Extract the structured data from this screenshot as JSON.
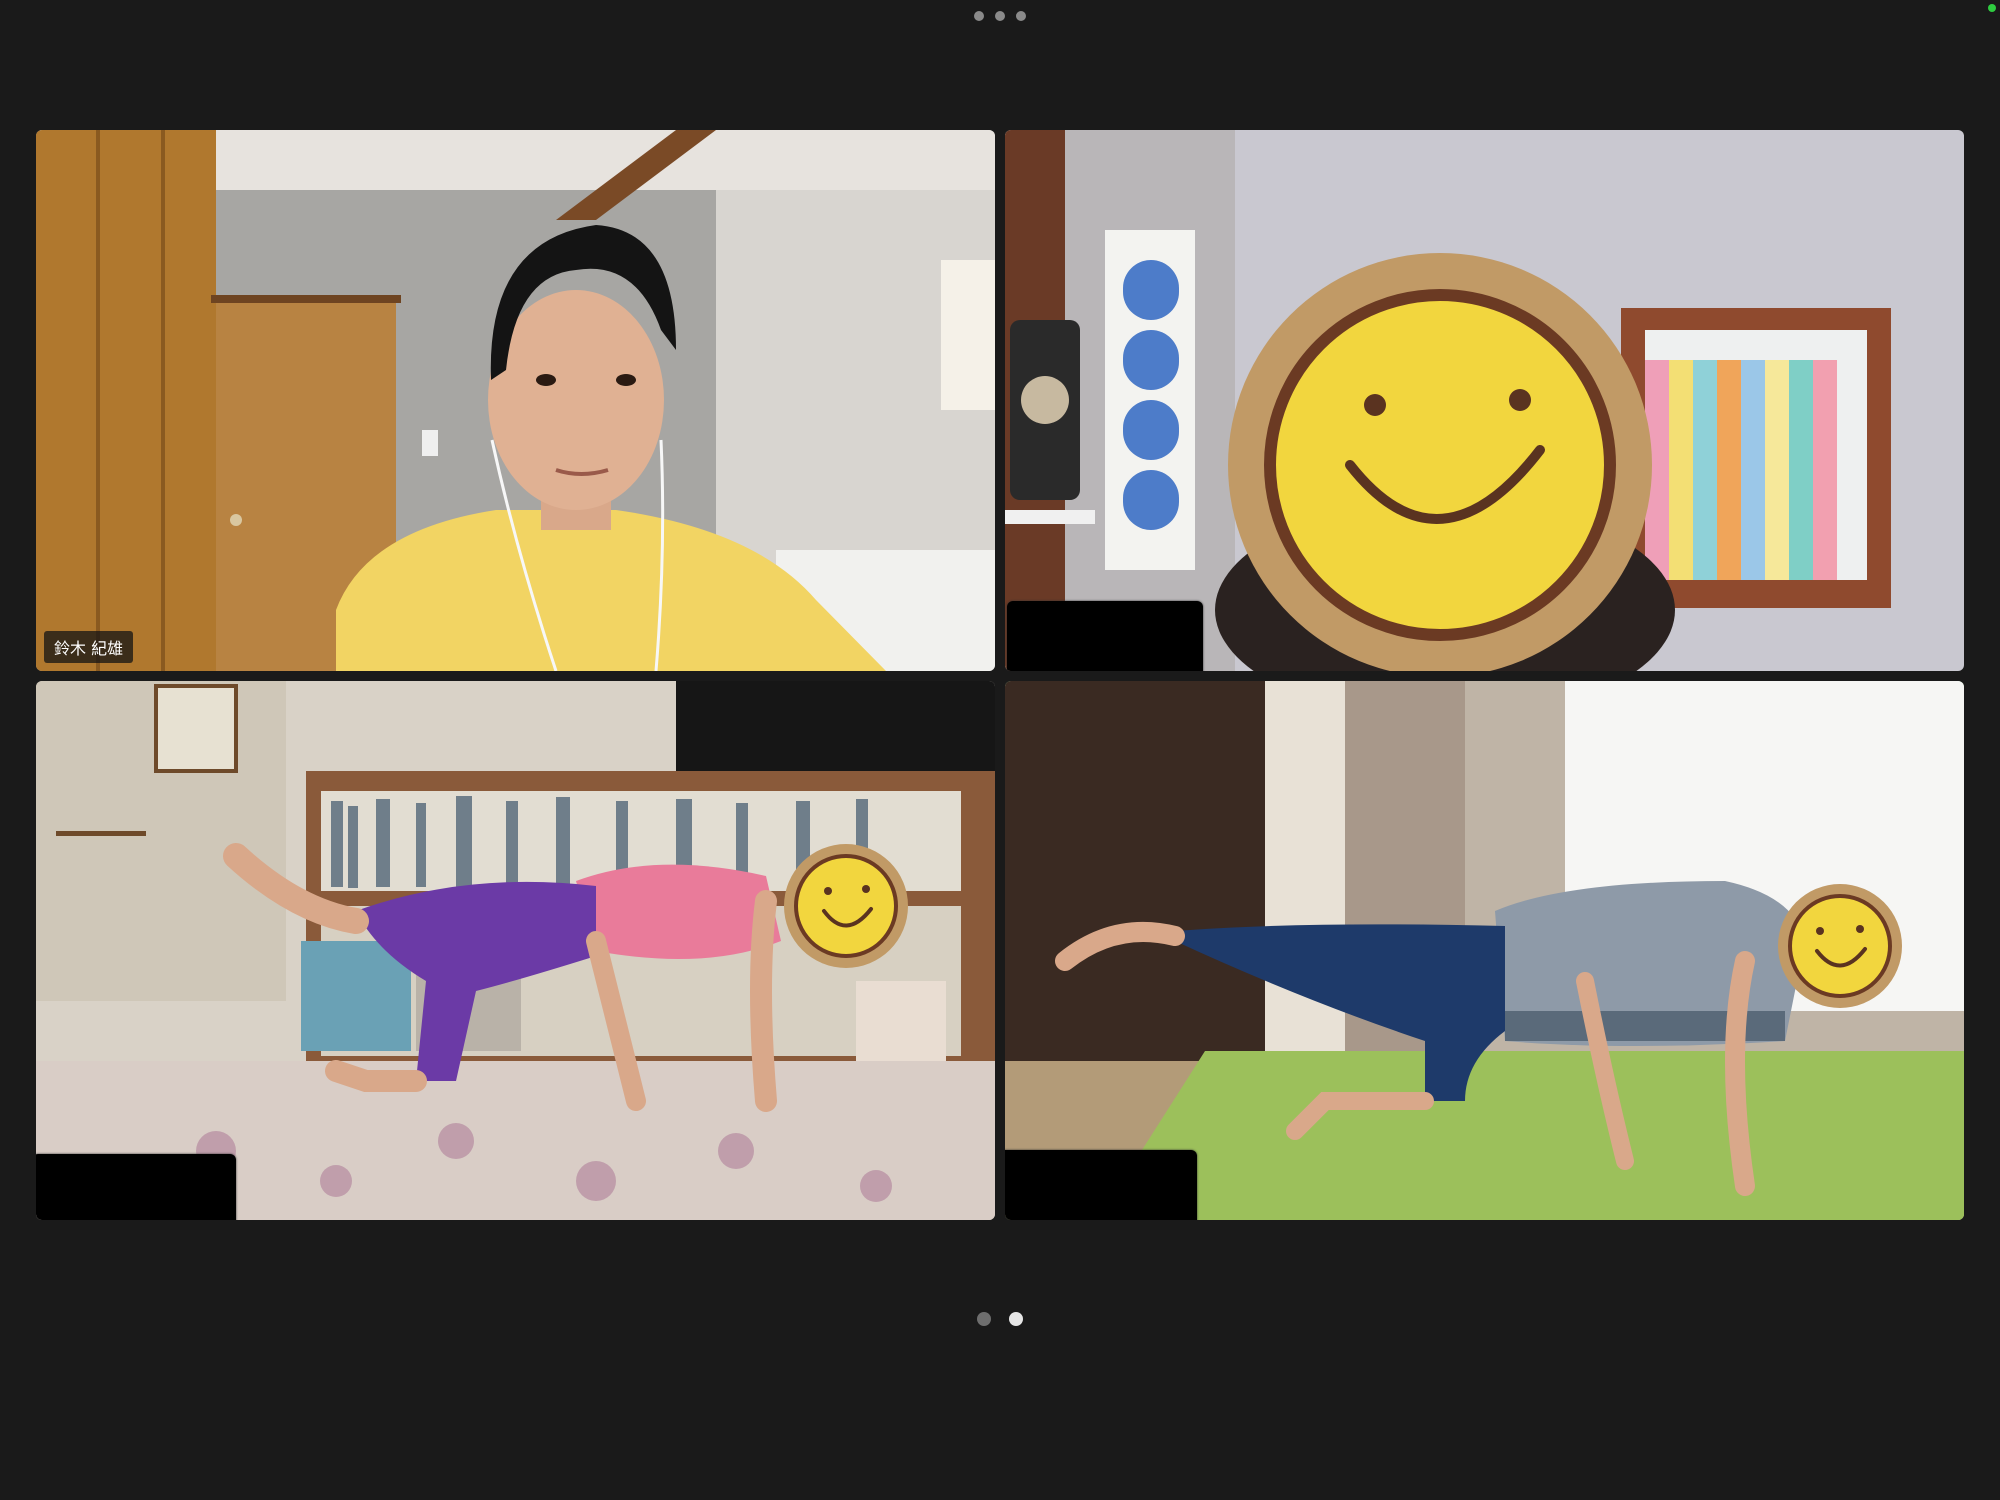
{
  "toolbar": {
    "more_icon": "ellipsis-horizontal-icon"
  },
  "colors": {
    "background": "#1a1a1a",
    "active_speaker_border": "#23d160",
    "status_indicator": "#2ecc40"
  },
  "participants": [
    {
      "name": "鈴木 紀雄",
      "name_visible": true,
      "active_speaker": false
    },
    {
      "name": "",
      "name_visible": false,
      "active_speaker": false,
      "redacted": true
    },
    {
      "name": "",
      "name_visible": false,
      "active_speaker": false,
      "redacted": true
    },
    {
      "name": "",
      "name_visible": false,
      "active_speaker": true,
      "redacted": true
    }
  ],
  "pagination": {
    "total_pages": 2,
    "current_page": 2
  }
}
